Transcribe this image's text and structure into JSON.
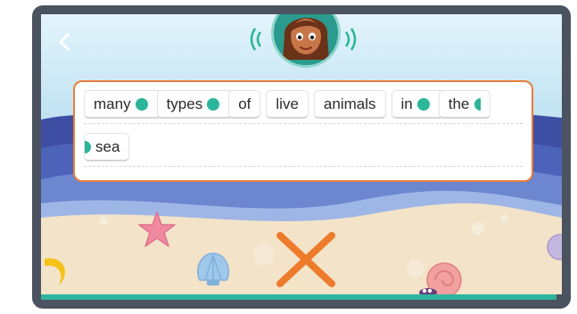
{
  "sentence": {
    "row1": [
      {
        "word": "many"
      },
      {
        "word": "types"
      },
      {
        "word": "of"
      },
      {
        "word": "live"
      },
      {
        "word": "animals"
      },
      {
        "word": "in"
      },
      {
        "word": "the"
      }
    ],
    "row2": [
      {
        "word": "sea"
      }
    ]
  },
  "icons": {
    "back": "chevron-left-icon",
    "avatar": "character-avatar",
    "wrong": "x-mark-icon"
  },
  "colors": {
    "accent": "#e97d3c",
    "teal": "#2bb59a",
    "frame": "#4b5360"
  },
  "progress": {
    "fraction": 0.99
  }
}
